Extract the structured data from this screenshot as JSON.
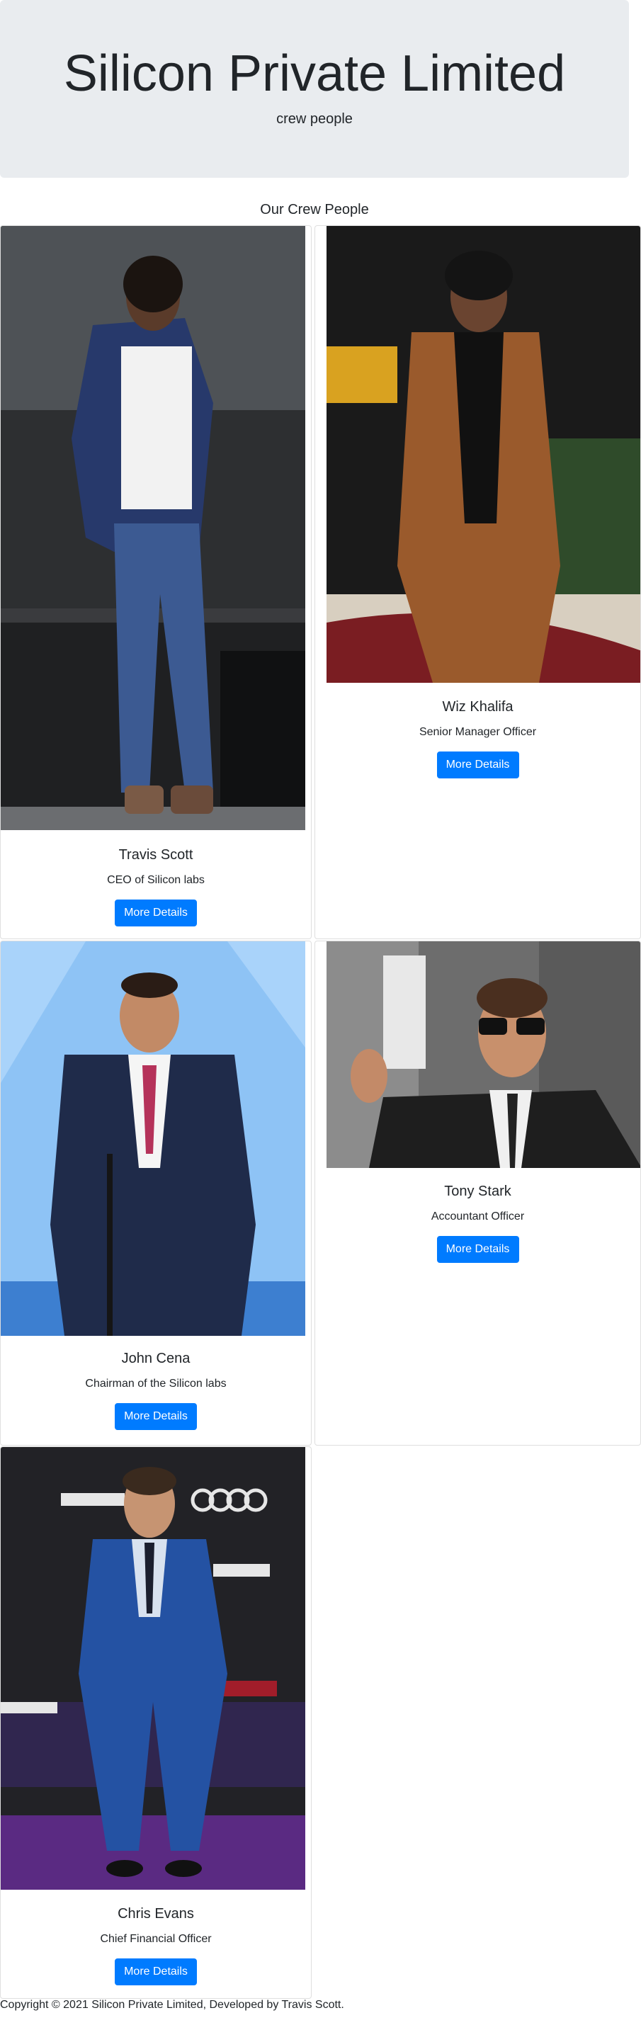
{
  "header": {
    "title": "Silicon Private Limited",
    "subtitle": "crew people"
  },
  "section": {
    "title": "Our Crew People"
  },
  "crew": [
    {
      "name": "Travis Scott",
      "role": "CEO of Silicon labs",
      "button": "More Details"
    },
    {
      "name": "Wiz Khalifa",
      "role": "Senior Manager Officer",
      "button": "More Details"
    },
    {
      "name": "John Cena",
      "role": "Chairman of the Silicon labs",
      "button": "More Details"
    },
    {
      "name": "Tony Stark",
      "role": "Accountant Officer",
      "button": "More Details"
    },
    {
      "name": "Chris Evans",
      "role": "Chief Financial Officer",
      "button": "More Details"
    }
  ],
  "footer": {
    "text": "Copyright © 2021 Silicon Private Limited, Developed by Travis Scott."
  },
  "colors": {
    "primary": "#007bff",
    "jumbotron_bg": "#e9ecef"
  }
}
